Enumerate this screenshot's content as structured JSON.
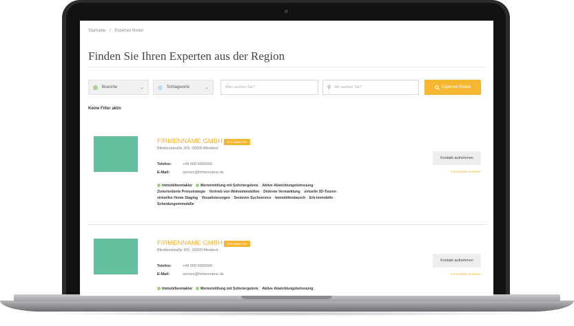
{
  "breadcrumb": {
    "home": "Startseite",
    "sep": "/",
    "current": "Experten finden"
  },
  "page": {
    "title": "Finden Sie Ihren Experten aus der Region"
  },
  "filters": {
    "branche": {
      "label": "Branche",
      "color": "#a7d58b"
    },
    "schlagworte": {
      "label": "Schlagworte",
      "color": "#bfe0ea"
    },
    "what_placeholder": "Wen suchen Sie?",
    "where_placeholder": "Wo suchen Sie?",
    "search_button": "Experten finden",
    "status": "Keine Filter aktiv"
  },
  "cards": [
    {
      "company": "FIRMENNAME GMBH",
      "badge": "TOP-ANBIETER",
      "address": "Blindtextstraße 205, 00000 Blindtext",
      "phone_label": "Telefon:",
      "phone": "+49 000 0000000",
      "email_label": "E-Mail:",
      "email": "service@firmenname.de",
      "contact_button": "Kontakt aufnehmen",
      "listing_link": "2 Immobilien ansehen",
      "tags_line1": [
        "Immobilienmakler",
        "Wertermittlung mit Sofortergebnis",
        "Aktive Abwicklungsbetreuung"
      ],
      "tags_line2": [
        "Zielorientierte Preisstrategie",
        "Vertrieb von Wohnimmobilien",
        "Diskrete Vermarktung",
        "virtuelle 3D-Touren"
      ],
      "tags_line3": [
        "virtuelles Home Staging",
        "Visualisierungen",
        "Senioren Suchservice",
        "Immobilientausch",
        "Erb-Immobilie"
      ],
      "tags_line4": [
        "Scheidungsimmobilie"
      ]
    },
    {
      "company": "FIRMENNAME GMBH",
      "badge": "TOP-ANBIETER",
      "address": "Blindtextstraße 205, 00000 Blindtext",
      "phone_label": "Telefon:",
      "phone": "+49 000 0000000",
      "email_label": "E-Mail:",
      "email": "service@firmenname.de",
      "contact_button": "Kontakt aufnehmen",
      "listing_link": "2 Immobilien ansehen",
      "tags_line1": [
        "Immobilienmakler",
        "Wertermittlung mit Sofortergebnis",
        "Aktive Abwicklungsbetreuung"
      ]
    }
  ],
  "icons": {
    "chevron": "chevron-down-icon",
    "pin": "location-pin-icon",
    "search": "search-icon"
  },
  "colors": {
    "accent": "#f5b731",
    "thumb": "#65bf9d"
  }
}
